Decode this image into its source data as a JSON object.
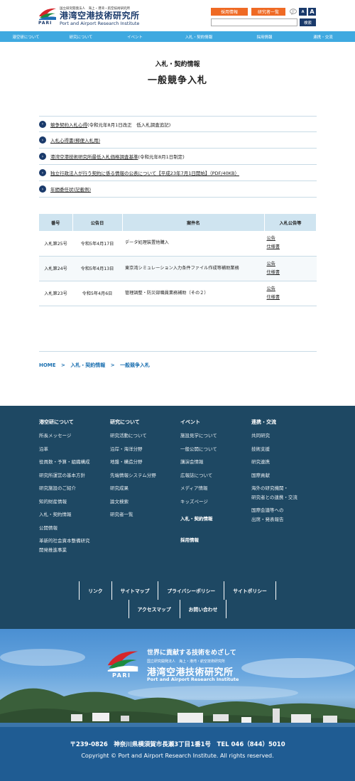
{
  "header": {
    "logo_small": "国立研究開発法人　海上・港湾・航空技術研究所",
    "logo_ja": "港湾空港技術研究所",
    "logo_en": "Port and Airport Research Institute",
    "logo_pari": "PARI",
    "recruit_label": "採用情報",
    "researchers_label": "研究者一覧",
    "font_small": "A",
    "font_large": "A",
    "search_placeholder": "",
    "search_button": "検索"
  },
  "nav": {
    "items": [
      {
        "label": "港空研について"
      },
      {
        "label": "研究について"
      },
      {
        "label": "イベント"
      },
      {
        "label": "入札・契約情報"
      },
      {
        "label": "採用情報"
      },
      {
        "label": "連携・交流"
      }
    ]
  },
  "page": {
    "subtitle": "入札・契約情報",
    "title": "一般競争入札"
  },
  "links": [
    {
      "link": "競争契約入札心得",
      "extra": "(令和元年8月1日改正　低入札調査追記)"
    },
    {
      "link": "入札心得書(郵便入札用)",
      "extra": ""
    },
    {
      "link": "港湾空港技術研究所最低入札価格調査基準",
      "extra": "(令和元年8月1日制定)"
    },
    {
      "link": "独立行政法人が行う契約に係る情報の公表について【平成23年7月1日開始】（PDF/40KB）",
      "extra": ""
    },
    {
      "link": "年間委任状(記載例)",
      "extra": ""
    }
  ],
  "table": {
    "headers": [
      "番号",
      "公告日",
      "案件名",
      "入札公告等"
    ],
    "rows": [
      {
        "no": "入札第25号",
        "date": "令和5年4月17日",
        "name": "データ処理装置他購入",
        "doc1": "公告",
        "doc2": "仕様書"
      },
      {
        "no": "入札第24号",
        "date": "令和5年4月13日",
        "name": "東京湾シミュレーション入力条件ファイル作成等補助業務",
        "doc1": "公告",
        "doc2": "仕様書"
      },
      {
        "no": "入札第23号",
        "date": "令和5年4月6日",
        "name": "管理調整・防災部職員業務補助（その２）",
        "doc1": "公告",
        "doc2": "仕様書"
      }
    ]
  },
  "breadcrumb": {
    "home": "HOME",
    "level1": "入札・契約情報",
    "level2": "一般競争入札",
    "sep": ">"
  },
  "footer": {
    "col1": {
      "head": "港空研について",
      "items": [
        "所長メッセージ",
        "沿革",
        "役員数・予算・組織構成",
        "研究所運営の基本方針",
        "研究施設のご紹介",
        "知的財産情報",
        "入札・契約情報",
        "公開情報"
      ],
      "multi": [
        "革新的社会資本整備研究",
        "開発推進事業"
      ]
    },
    "col2": {
      "head": "研究について",
      "items": [
        "研究活動について",
        "沿岸・海洋分野",
        "地盤・構造分野",
        "先端情報システム分野",
        "研究成果",
        "論文検索",
        "研究者一覧"
      ]
    },
    "col3": {
      "head": "イベント",
      "items": [
        "施設見学について",
        "一般公開について",
        "講演会情報",
        "広報誌について",
        "メディア情報",
        "キッズページ"
      ],
      "sub1": "入札・契約情報",
      "sub2": "採用情報"
    },
    "col4": {
      "head": "連携・交流",
      "items": [
        "共同研究",
        "技術支援",
        "研究連携",
        "国際貢献"
      ],
      "multi1": [
        "海外の研究機関・",
        "研究者との連携・交流"
      ],
      "multi2": [
        "国際会議等への",
        "出席・発表報告"
      ]
    },
    "links_row1": [
      "リンク",
      "サイトマップ",
      "プライバシーポリシー",
      "サイトポリシー"
    ],
    "links_row2": [
      "アクセスマップ",
      "お問い合わせ"
    ]
  },
  "banner": {
    "tagline": "世界に貢献する技術をめざして",
    "small": "国立研究開発法人　海上・港湾・航空技術研究所",
    "ja": "港湾空港技術研究所",
    "en": "Port and Airport Research Institute",
    "pari": "PARI",
    "address": "〒239-0826　神奈川県横須賀市長瀬3丁目1番1号　TEL 046（844）5010",
    "copyright": "Copyright © Port and Airport Research Institute. All rights reserved."
  },
  "colors": {
    "nav": "#3fa9e0",
    "orange": "#ef6a24",
    "navy": "#1a3a6b",
    "footer": "#1e4863",
    "table_header": "#cfe4f0"
  }
}
